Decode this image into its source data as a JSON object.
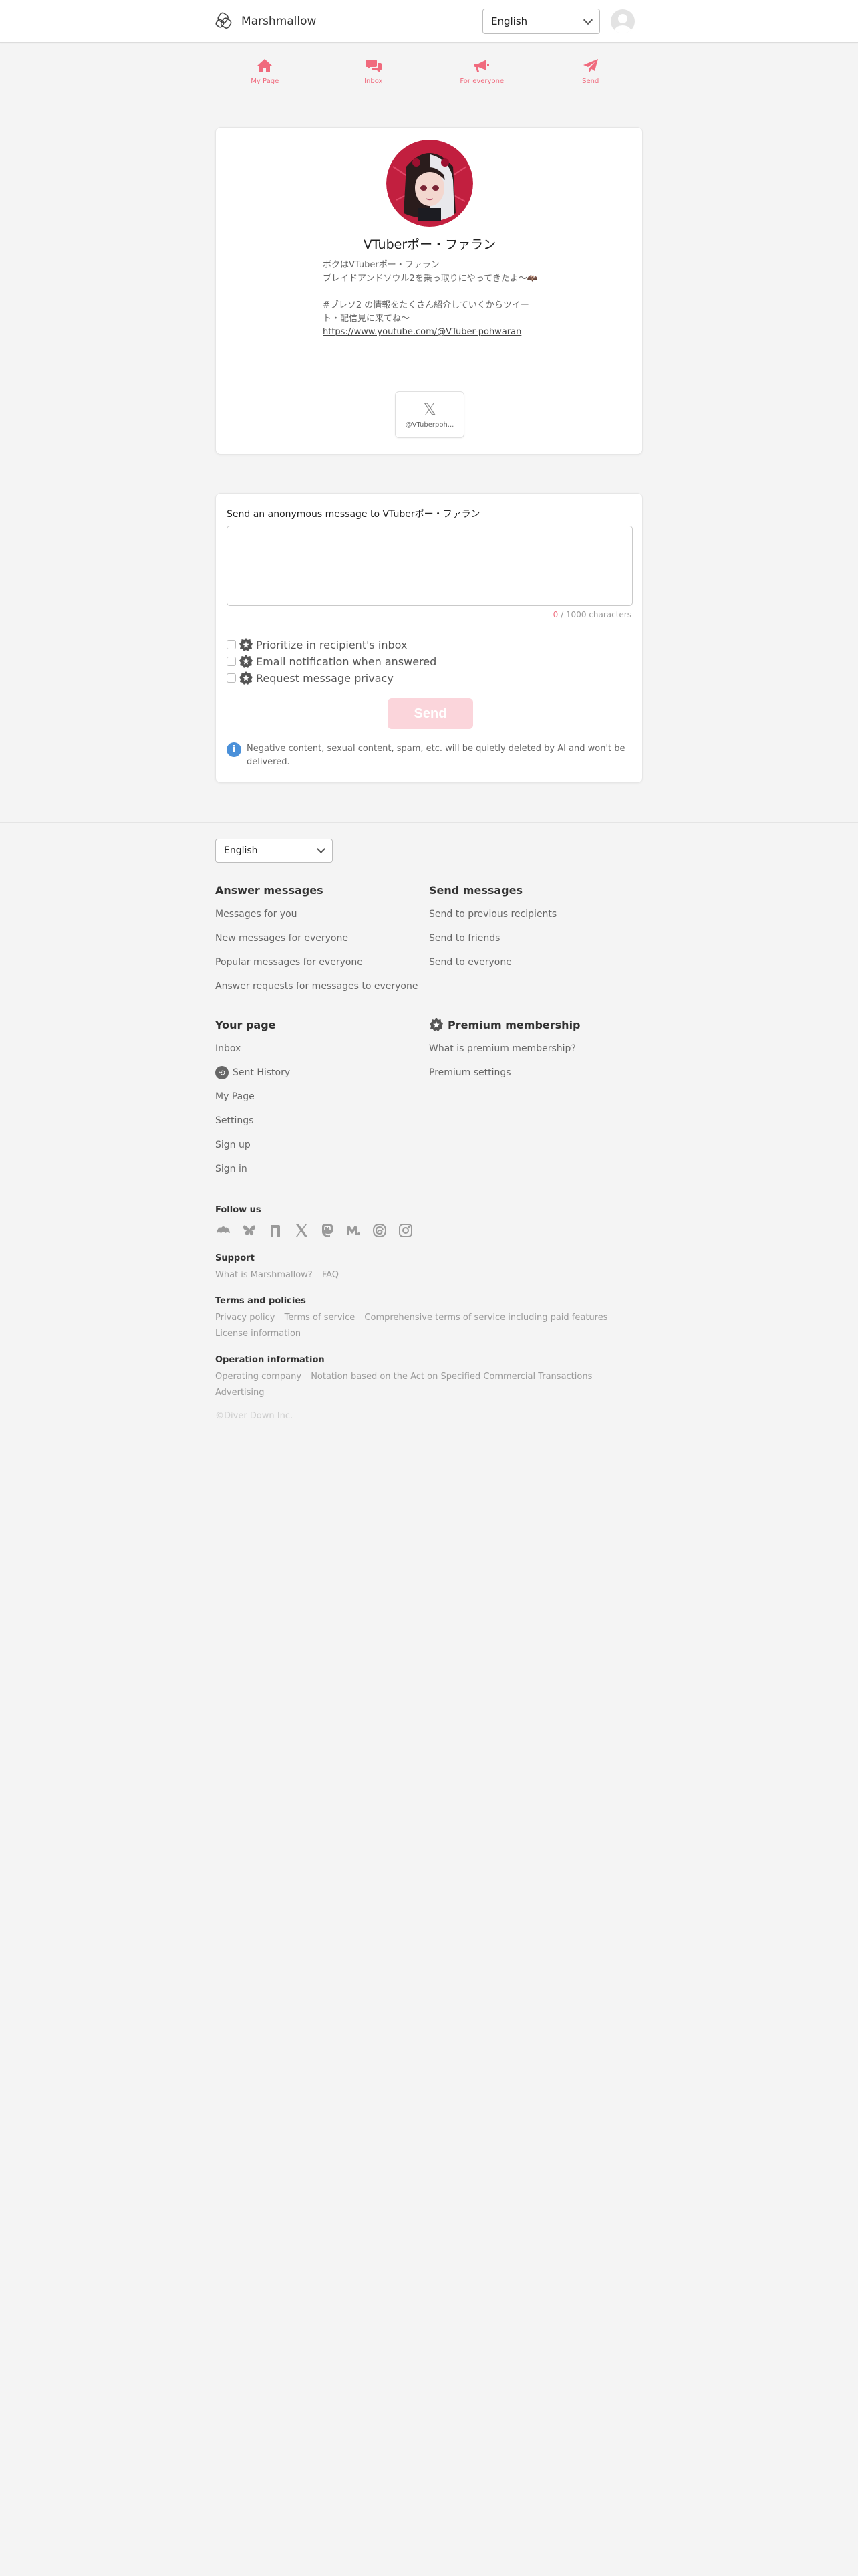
{
  "header": {
    "app_name": "Marshmallow",
    "language": "English",
    "logo_icon": "marshmallow-logo-icon",
    "avatar_icon": "user-avatar-icon"
  },
  "nav": {
    "items": [
      {
        "label": "My Page",
        "icon": "home-icon"
      },
      {
        "label": "Inbox",
        "icon": "chat-bubbles-icon"
      },
      {
        "label": "For everyone",
        "icon": "megaphone-icon"
      },
      {
        "label": "Send",
        "icon": "paper-plane-icon"
      }
    ]
  },
  "profile": {
    "name": "VTuberポー・ファラン",
    "bio_line1": "ボクはVTuberポー・ファラン",
    "bio_line2": "ブレイドアンドソウル2を乗っ取りにやってきたよ〜🦇",
    "bio_line3": "#ブレソ2 の情報をたくさん紹介していくからツイート・配信見に来てね〜",
    "bio_url": "https://www.youtube.com/@VTuber-pohwaran",
    "social_handle": "@VTuberpoh...",
    "social_icon": "x-icon"
  },
  "message_form": {
    "title": "Send an anonymous message to VTuberポー・ファラン",
    "placeholder": "",
    "char_count": "0",
    "char_limit": "/ 1000 characters",
    "options": [
      {
        "label": "Prioritize in recipient's inbox",
        "checked": false
      },
      {
        "label": "Email notification when answered",
        "checked": false
      },
      {
        "label": "Request message privacy",
        "checked": false
      }
    ],
    "send_label": "Send",
    "notice": "Negative content, sexual content, spam, etc. will be quietly deleted by AI and won't be delivered."
  },
  "footer": {
    "language": "English",
    "answer_messages": {
      "title": "Answer messages",
      "links": [
        "Messages for you",
        "New messages for everyone",
        "Popular messages for everyone",
        "Answer requests for messages to everyone"
      ]
    },
    "send_messages": {
      "title": "Send messages",
      "links": [
        "Send to previous recipients",
        "Send to friends",
        "Send to everyone"
      ]
    },
    "your_page": {
      "title": "Your page",
      "links": [
        "Inbox",
        "Sent History",
        "My Page",
        "Settings",
        "Sign up",
        "Sign in"
      ]
    },
    "premium": {
      "title": "Premium membership",
      "links": [
        "What is premium membership?",
        "Premium settings"
      ]
    },
    "follow_us": "Follow us",
    "social_icons": [
      "marshmallow-icon",
      "bluesky-icon",
      "note-icon",
      "x-icon",
      "mastodon-icon",
      "misskey-icon",
      "threads-icon",
      "instagram-icon"
    ],
    "support": {
      "title": "Support",
      "links": [
        "What is Marshmallow?",
        "FAQ"
      ]
    },
    "terms": {
      "title": "Terms and policies",
      "links": [
        "Privacy policy",
        "Terms of service",
        "Comprehensive terms of service including paid features",
        "License information"
      ]
    },
    "operation": {
      "title": "Operation information",
      "links": [
        "Operating company",
        "Notation based on the Act on Specified Commercial Transactions",
        "Advertising"
      ]
    },
    "copyright": "©Diver Down Inc."
  },
  "colors": {
    "accent": "#f06a7d",
    "send_disabled": "#fbd5db",
    "info": "#4a90d9",
    "background": "#f4f4f4"
  }
}
